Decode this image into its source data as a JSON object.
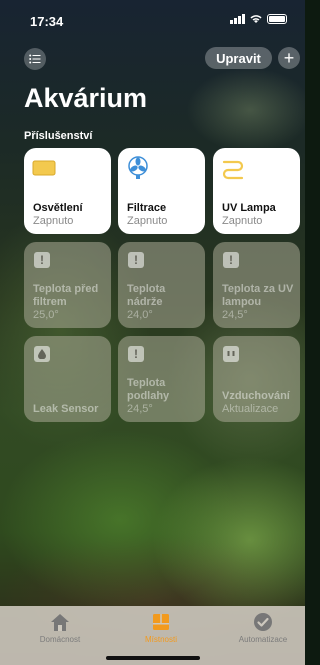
{
  "status_bar": {
    "time": "17:34"
  },
  "header": {
    "edit_label": "Upravit",
    "add_label": "+"
  },
  "title": "Akvárium",
  "section_label": "Příslušenství",
  "tiles": [
    {
      "name": "Osvětlení",
      "status": "Zapnuto",
      "icon": "light-panel-icon",
      "state": "on"
    },
    {
      "name": "Filtrace",
      "status": "Zapnuto",
      "icon": "fan-icon",
      "state": "on"
    },
    {
      "name": "UV Lampa",
      "status": "Zapnuto",
      "icon": "uv-lamp-icon",
      "state": "on"
    },
    {
      "name": "Teplota před filtrem",
      "status": "25,0°",
      "icon": "alert-icon",
      "state": "off"
    },
    {
      "name": "Teplota nádrže",
      "status": "24,0°",
      "icon": "alert-icon",
      "state": "off"
    },
    {
      "name": "Teplota za UV lampou",
      "status": "24,5°",
      "icon": "alert-icon",
      "state": "off"
    },
    {
      "name": "Leak Sensor",
      "status": "",
      "icon": "drop-icon",
      "state": "off"
    },
    {
      "name": "Teplota podlahy",
      "status": "24,5°",
      "icon": "alert-icon",
      "state": "off"
    },
    {
      "name": "Vzduchování",
      "status": "Aktualizace",
      "icon": "outlet-icon",
      "state": "off"
    }
  ],
  "tabs": [
    {
      "label": "Domácnost",
      "icon": "house-icon",
      "active": false
    },
    {
      "label": "Místnosti",
      "icon": "rooms-icon",
      "active": true
    },
    {
      "label": "Automatizace",
      "icon": "automation-icon",
      "active": false
    }
  ],
  "colors": {
    "accent": "#f29a1e",
    "light_icon": "#f3c94e",
    "fan_icon": "#3e8fd8"
  }
}
